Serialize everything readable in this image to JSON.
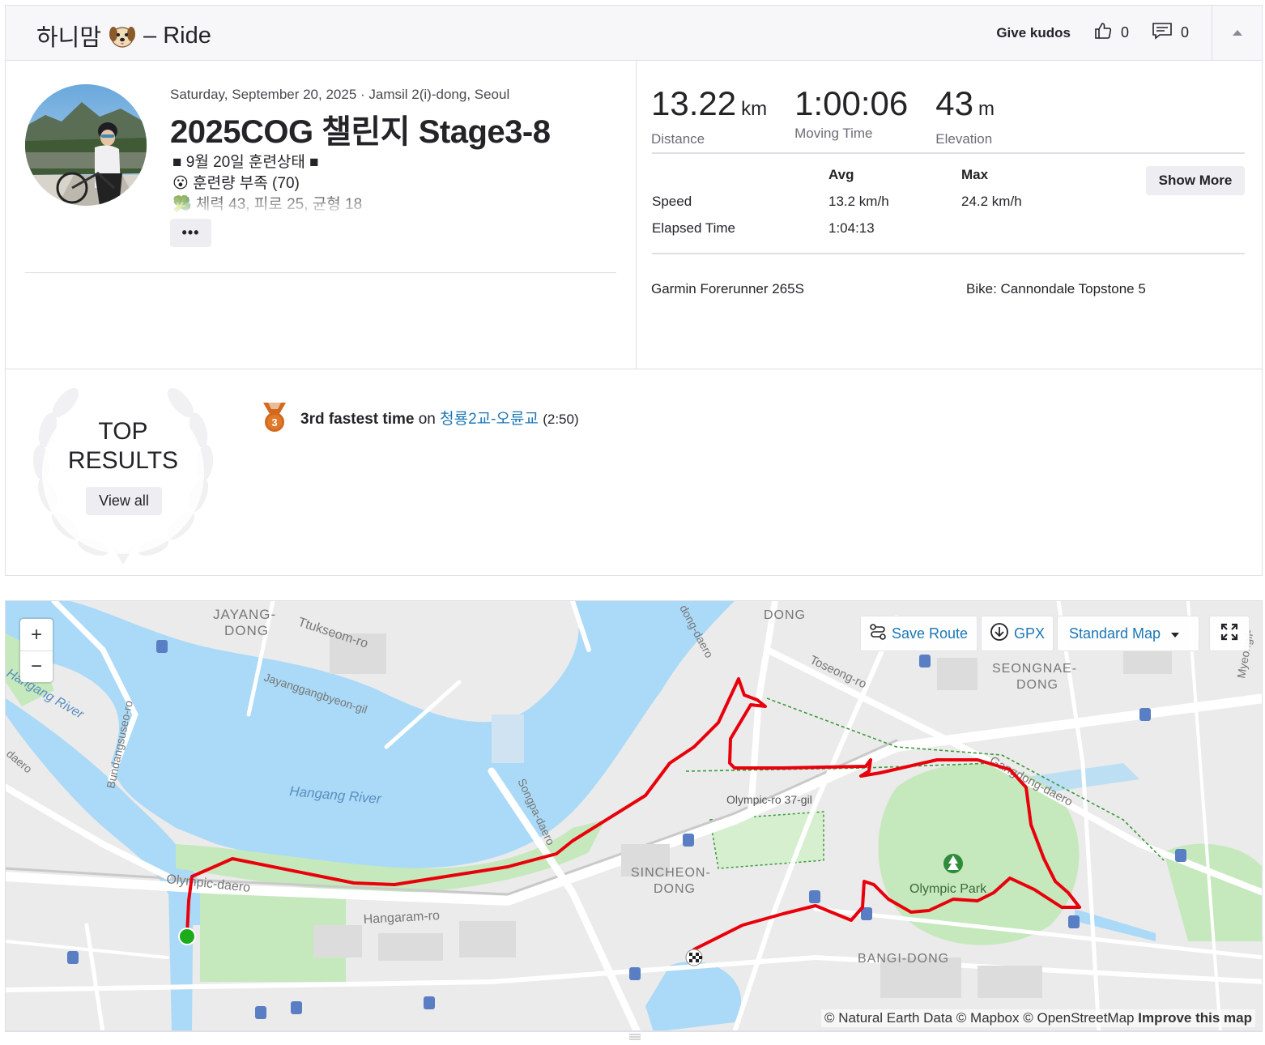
{
  "header": {
    "athlete_name": "하니맘",
    "separator": "– Ride",
    "give_kudos": "Give kudos",
    "kudos_count": "0",
    "comment_count": "0"
  },
  "activity": {
    "meta": "Saturday, September 20, 2025 · Jamsil 2(i)-dong, Seoul",
    "title": "2025COG 챌린지 Stage3-8",
    "description": [
      "■ 9월 20일 훈련상태 ■",
      "😮 훈련량 부족 (70)",
      "🥦 체력 43, 피로 25, 균형 18"
    ],
    "more_label": "•••"
  },
  "stats": {
    "distance": {
      "value": "13.22",
      "unit": "km",
      "label": "Distance"
    },
    "moving_time": {
      "value": "1:00:06",
      "label": "Moving Time"
    },
    "elevation": {
      "value": "43",
      "unit": "m",
      "label": "Elevation"
    },
    "table": {
      "headers": [
        "Avg",
        "Max"
      ],
      "rows": [
        {
          "label": "Speed",
          "avg": "13.2 km/h",
          "max": "24.2 km/h"
        },
        {
          "label": "Elapsed Time",
          "avg": "1:04:13",
          "max": ""
        }
      ]
    },
    "show_more": "Show More",
    "device": "Garmin Forerunner 265S",
    "bike": "Bike: Cannondale Topstone 5"
  },
  "top_results": {
    "title_line1": "TOP",
    "title_line2": "RESULTS",
    "view_all": "View all",
    "achievement": {
      "rank": "3",
      "strong": "3rd fastest time",
      "on": "on",
      "segment": "청룡2교-오륜교",
      "time": "(2:50)"
    }
  },
  "map": {
    "zoom_in": "+",
    "zoom_out": "−",
    "save_route": "Save Route",
    "gpx": "GPX",
    "map_style": "Standard Map",
    "attribution": "© Natural Earth Data © Mapbox © OpenStreetMap",
    "improve": "Improve this map",
    "labels": {
      "jayang": "JAYANG-",
      "jayang2": "DONG",
      "tukseom": "Ttukseom-ro",
      "jayanggang": "Jayanggangbyeon-gil",
      "hangang_river_left": "Hangang River",
      "hangang_river": "Hangang River",
      "bundang": "Bundangsuseo-ro",
      "daero_left": "daero",
      "songpa": "Songpa-daero",
      "olympic_daero": "Olympic-daero",
      "hangaram": "Hangaram-ro",
      "olympic37": "Olympic-ro 37-gil",
      "sincheon1": "SINCHEON-",
      "sincheon2": "DONG",
      "olympic_park": "Olympic Park",
      "bangi": "BANGI-DONG",
      "seongnae1": "SEONGNAE-",
      "seongnae2": "DONG",
      "toseong": "Toseong-ro",
      "gangdong": "Gangdong-daero",
      "dong_top": "DONG",
      "dong_daero": "dong-daero",
      "myeongil": "Myeongil-"
    },
    "route_color": "#e8000b",
    "start_color": "#1bab1b"
  },
  "colors": {
    "accent_link": "#1b77b6",
    "medal": "#d2691e",
    "water": "#aadaf7",
    "park": "#c6e8bd"
  }
}
